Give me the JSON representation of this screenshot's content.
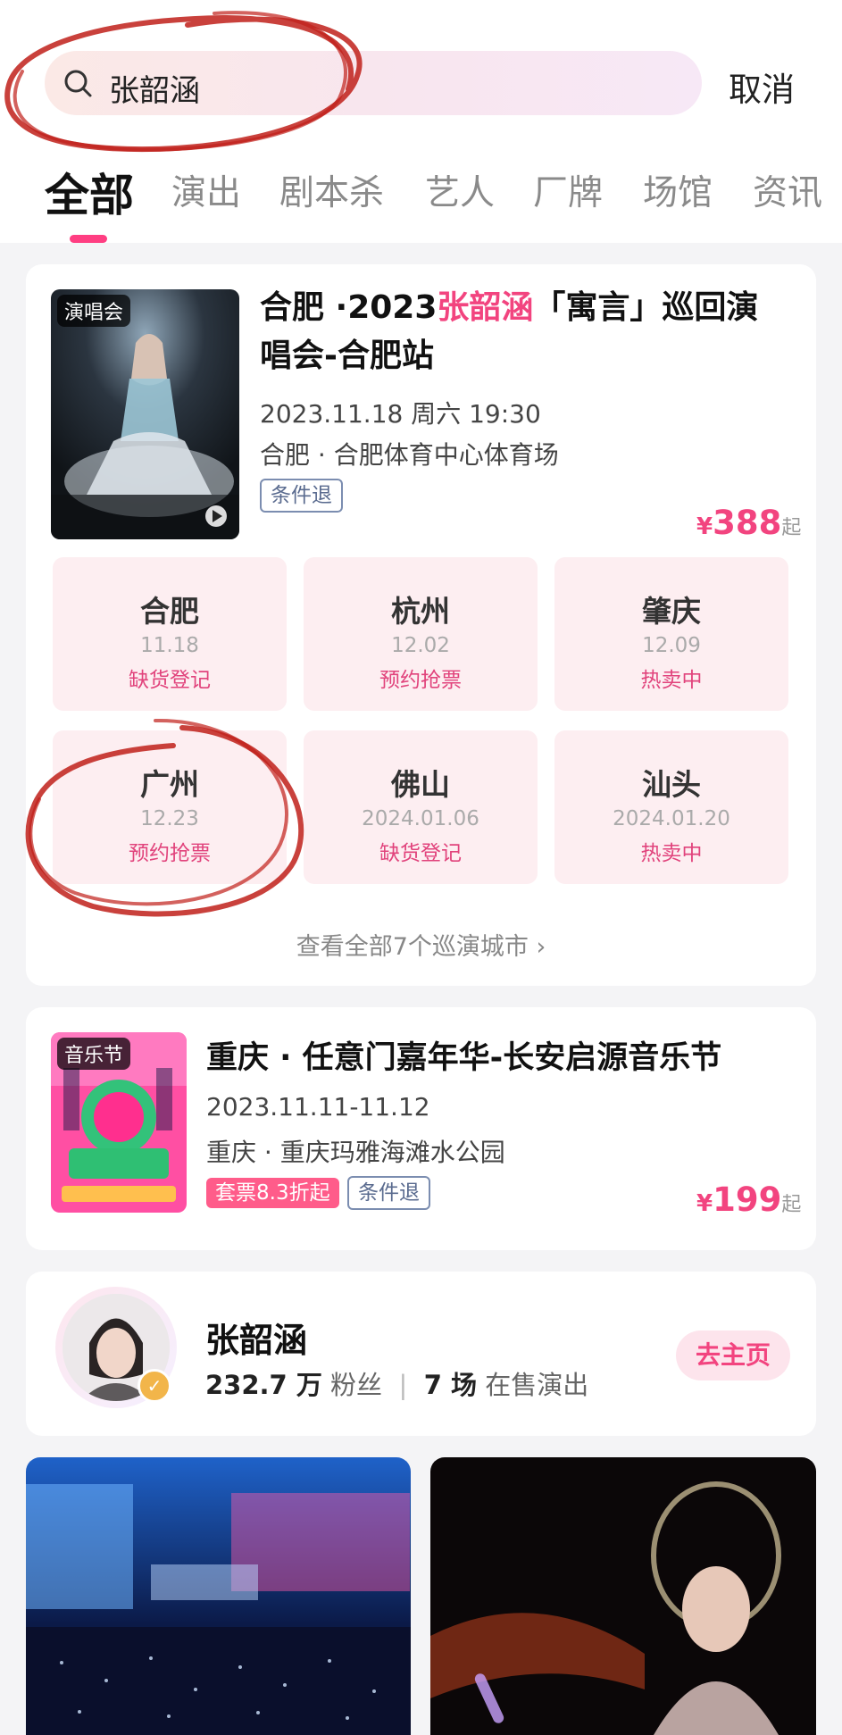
{
  "search": {
    "query": "张韶涵",
    "cancel_label": "取消"
  },
  "tabs": [
    "全部",
    "演出",
    "剧本杀",
    "艺人",
    "厂牌",
    "场馆",
    "资讯"
  ],
  "concert": {
    "badge": "演唱会",
    "title_prefix": "合肥 ·2023",
    "title_highlight": "张韶涵",
    "title_suffix": "「寓言」巡回演唱会-合肥站",
    "datetime": "2023.11.18 周六 19:30",
    "venue": "合肥 · 合肥体育中心体育场",
    "tag": "条件退",
    "price_currency": "¥",
    "price": "388",
    "price_suffix": "起",
    "cities": [
      {
        "name": "合肥",
        "date": "11.18",
        "status": "缺货登记"
      },
      {
        "name": "杭州",
        "date": "12.02",
        "status": "预约抢票"
      },
      {
        "name": "肇庆",
        "date": "12.09",
        "status": "热卖中"
      },
      {
        "name": "广州",
        "date": "12.23",
        "status": "预约抢票"
      },
      {
        "name": "佛山",
        "date": "2024.01.06",
        "status": "缺货登记"
      },
      {
        "name": "汕头",
        "date": "2024.01.20",
        "status": "热卖中"
      }
    ],
    "more_label": "查看全部7个巡演城市 ›"
  },
  "festival": {
    "badge": "音乐节",
    "title": "重庆 · 任意门嘉年华-长安启源音乐节",
    "datetime": "2023.11.11-11.12",
    "venue": "重庆 · 重庆玛雅海滩水公园",
    "tag_discount": "套票8.3折起",
    "tag_refund": "条件退",
    "price_currency": "¥",
    "price": "199",
    "price_suffix": "起"
  },
  "artist": {
    "name": "张韶涵",
    "fans_count": "232.7 万",
    "fans_label": "粉丝",
    "separator": "|",
    "shows_count": "7 场",
    "shows_label": "在售演出",
    "home_button": "去主页"
  },
  "colors": {
    "accent": "#f2447f",
    "tab_indicator": "#ff3e82",
    "city_bg": "#fdeef1",
    "scribble": "#c0201a"
  }
}
